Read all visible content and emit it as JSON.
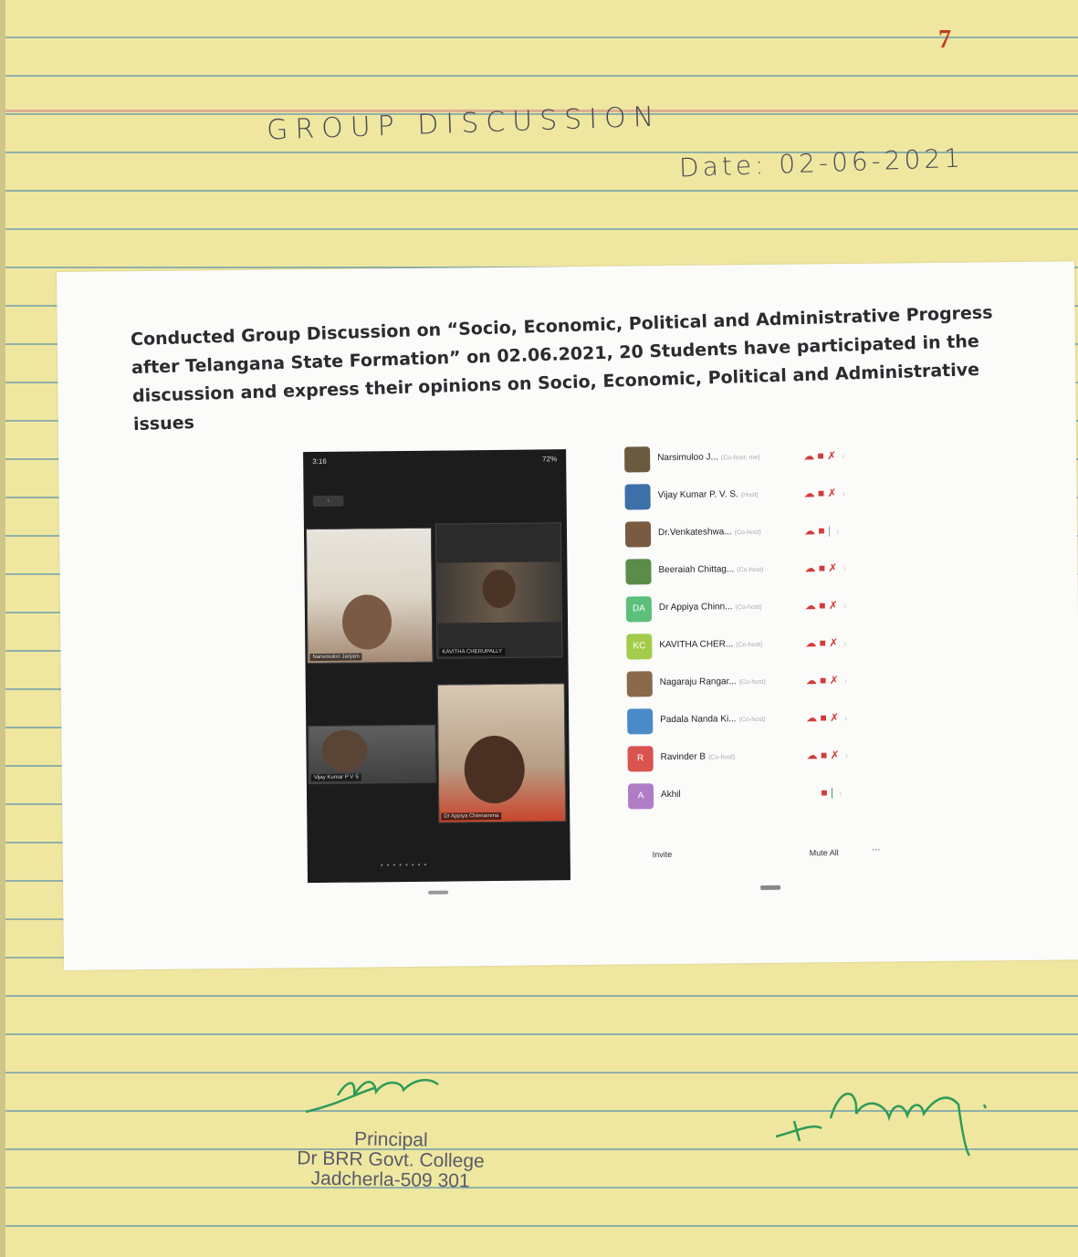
{
  "page_number": "7",
  "heading": "GROUP DISCUSSION",
  "date": "Date: 02-06-2021",
  "caption": "Conducted Group Discussion on “Socio, Economic, Political and Administrative Progress after Telangana State Formation” on 02.06.2021, 20 Students have participated in the discussion and express their opinions on  Socio, Economic, Political and Administrative issues",
  "phone": {
    "time": "3:16",
    "battery": "72%",
    "tiles": [
      "Narsimuloo Janjam",
      "KAVITHA CHERUPALLY",
      "Vijay Kumar P V S",
      "Dr Appiya Chinnamma"
    ]
  },
  "participants": [
    {
      "name": "Narsimuloo J...",
      "role": "(Co-host, me)",
      "avatar": "",
      "color": "#6b5a3e"
    },
    {
      "name": "Vijay Kumar P. V. S.",
      "role": "(Host)",
      "avatar": "",
      "color": "#3d6fa8"
    },
    {
      "name": "Dr.Venkateshwa...",
      "role": "(Co-host)",
      "avatar": "",
      "color": "#7a5a40"
    },
    {
      "name": "Beeraiah Chittag...",
      "role": "(Co-host)",
      "avatar": "",
      "color": "#5b8c4a"
    },
    {
      "name": "Dr Appiya Chinn...",
      "role": "(Co-host)",
      "avatar": "DA",
      "color": "#5cbf7a"
    },
    {
      "name": "KAVITHA CHER...",
      "role": "(Co-host)",
      "avatar": "KC",
      "color": "#a3cc4a"
    },
    {
      "name": "Nagaraju Rangar...",
      "role": "(Co-host)",
      "avatar": "",
      "color": "#8a6a4a"
    },
    {
      "name": "Padala Nanda Ki...",
      "role": "(Co-host)",
      "avatar": "",
      "color": "#4a8ac9"
    },
    {
      "name": "Ravinder B",
      "role": "(Co-host)",
      "avatar": "R",
      "color": "#d9534f"
    },
    {
      "name": "Akhil",
      "role": "",
      "avatar": "A",
      "color": "#b07cc6"
    }
  ],
  "footer": {
    "invite": "Invite",
    "mute_all": "Mute All",
    "more": "···"
  },
  "stamp": {
    "line1": "Principal",
    "line2": "Dr BRR Govt. College",
    "line3": "Jadcherla-509 301"
  }
}
